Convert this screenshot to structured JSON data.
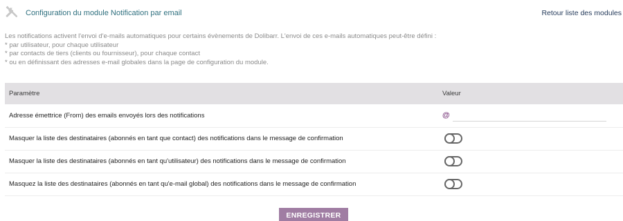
{
  "header": {
    "icon": "tools-icon",
    "title": "Configuration du module Notification par email",
    "back_link": "Retour liste des modules"
  },
  "intro": {
    "line1": "Les notifications activent l'envoi d'e-mails automatiques pour certains évènements de Dolibarr. L'envoi de ces e-mails automatiques peut-être défini :",
    "line2": "* par utilisateur, pour chaque utilisateur",
    "line3": "* par contacts de tiers (clients ou fournisseur), pour chaque contact",
    "line4": "* ou en définissant des adresses e-mail globales dans la page de configuration du module."
  },
  "table": {
    "col_param": "Paramètre",
    "col_value": "Valeur",
    "rows": [
      {
        "label": "Adresse émettrice (From) des emails envoyés lors des notifications",
        "type": "email",
        "value": "",
        "icon": "at-icon"
      },
      {
        "label": "Masquer la liste des destinataires (abonnés en tant que contact) des notifications dans le message de confirmation",
        "type": "toggle",
        "state": "off"
      },
      {
        "label": "Masquer la liste des destinataires (abonnés en tant qu'utilisateur) des notifications dans le message de confirmation",
        "type": "toggle",
        "state": "off"
      },
      {
        "label": "Masquez la liste des destinataires (abonnés en tant qu'e-mail global) des notifications dans le message de confirmation",
        "type": "toggle",
        "state": "off"
      }
    ]
  },
  "save_label": "ENREGISTRER",
  "colors": {
    "title": "#2e6f7e",
    "header_bg": "#e2e0e3",
    "button": "#a07da3",
    "at_icon": "#7b3d7d"
  }
}
